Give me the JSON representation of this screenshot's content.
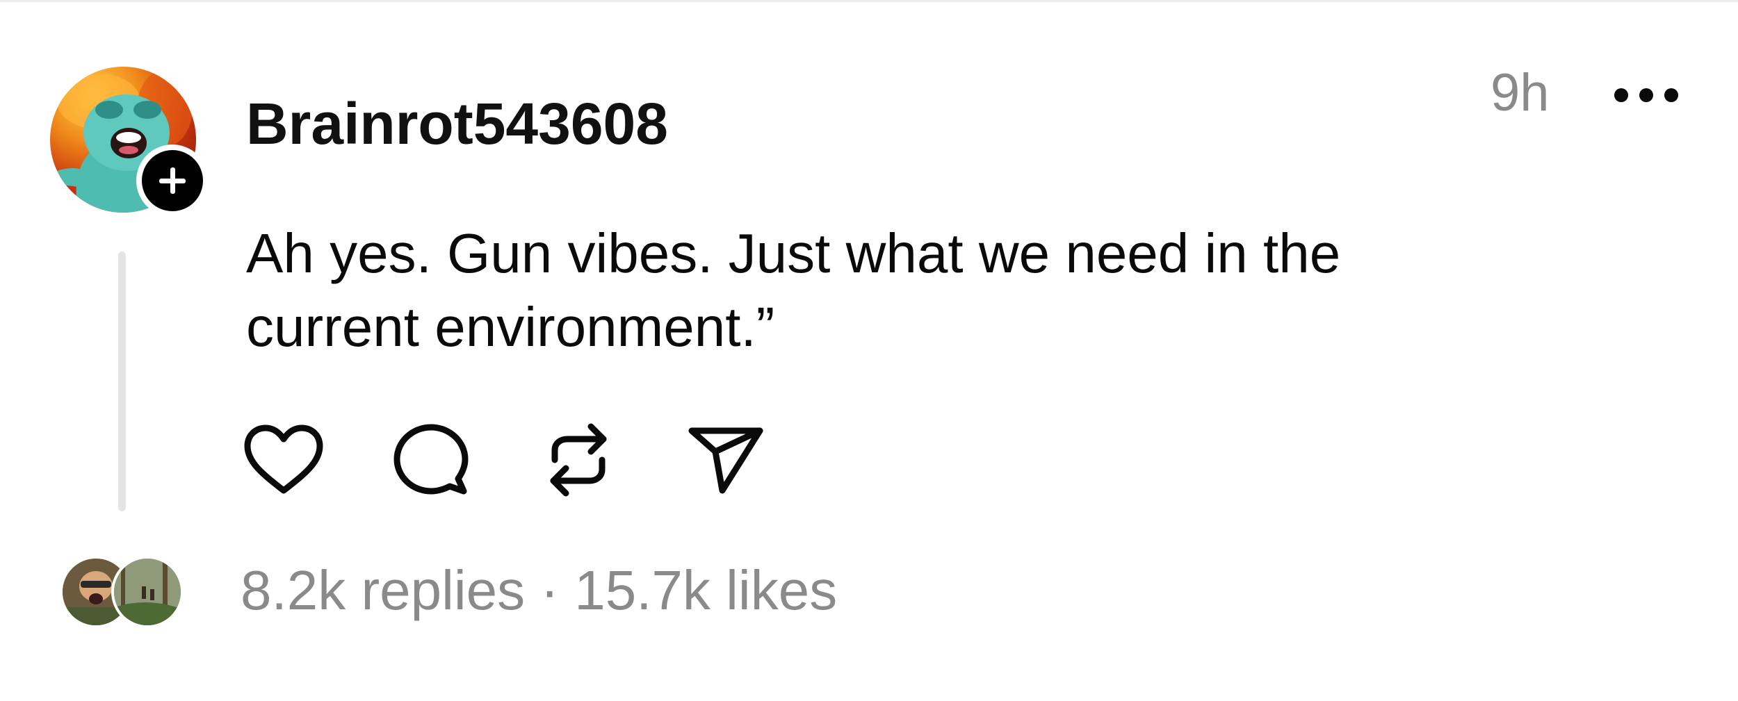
{
  "post": {
    "author": {
      "username": "Brainrot543608",
      "avatar_icon": "avatar-cartoon-face",
      "follow_icon": "plus-icon"
    },
    "timestamp": "9h",
    "more_icon": "more-icon",
    "text": "Ah yes. Gun vibes. Just what we need in the current environment.”",
    "actions": [
      {
        "name": "like",
        "icon": "heart-icon"
      },
      {
        "name": "reply",
        "icon": "comment-icon"
      },
      {
        "name": "repost",
        "icon": "repost-icon"
      },
      {
        "name": "share",
        "icon": "send-icon"
      }
    ],
    "stats": {
      "replies": "8.2k replies",
      "separator": "·",
      "likes": "15.7k likes"
    }
  },
  "colors": {
    "text": "#0a0a0a",
    "muted": "#8a8a8a",
    "thread_line": "#e4e4e4",
    "badge": "#000000"
  }
}
